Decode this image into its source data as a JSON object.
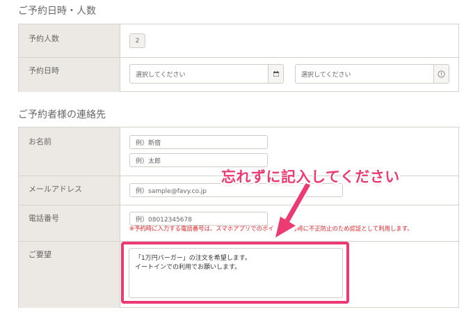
{
  "sections": {
    "datetime_title": "ご予約日時・人数",
    "contact_title": "ご予約者様の連絡先"
  },
  "reservation": {
    "people_label": "予約人数",
    "people_value": "2",
    "date_label": "予約日時",
    "date_placeholder": "選択してください",
    "time_placeholder": "選択してください"
  },
  "contact": {
    "name_label": "お名前",
    "name_placeholder_1": "例）新宿",
    "name_placeholder_2": "例）太郎",
    "email_label": "メールアドレス",
    "email_placeholder": "例）sample@favy.co.jp",
    "phone_label": "電話番号",
    "phone_placeholder": "例）08012345678",
    "phone_notice": "※予約時に入力する電話番号は、スマホアプリでのポイント付与時に不正防止のため認証として利用します。",
    "request_label": "ご要望",
    "request_line_1": "「1万円バーガー」の注文を希望します。",
    "request_line_2": "イートインでの利用でお願いします。"
  },
  "annotation": {
    "callout_text": "忘れずに記入してください",
    "color": "#ec3b73"
  },
  "icons": {
    "calendar": "calendar-icon",
    "info": "info-icon"
  }
}
